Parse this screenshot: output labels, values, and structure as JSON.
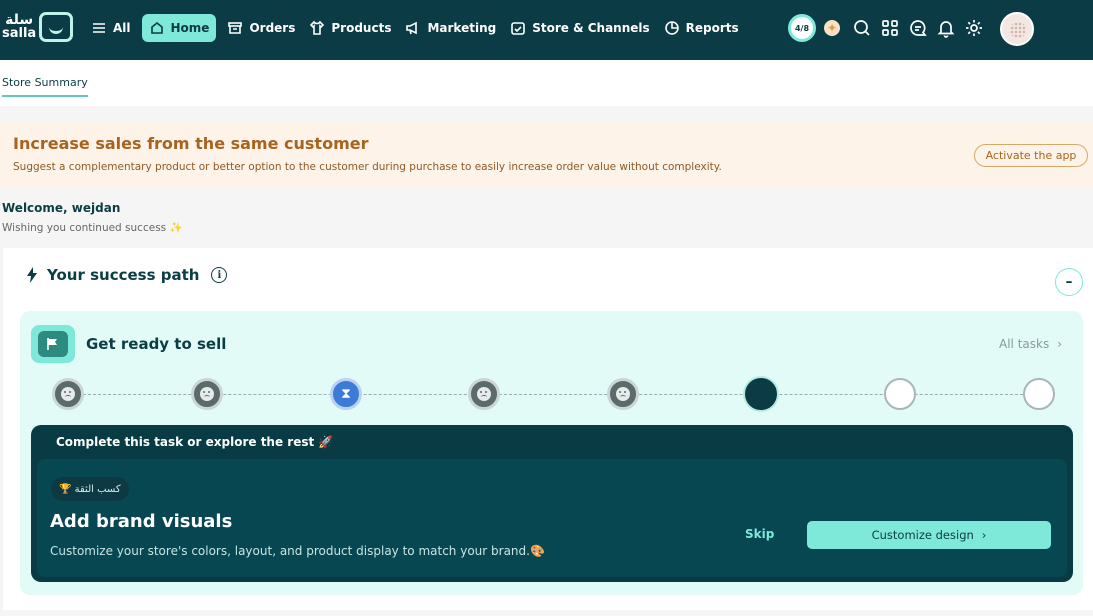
{
  "brand": {
    "name_ar": "سلة",
    "name_en": "salla"
  },
  "nav": {
    "items": [
      {
        "label": "All",
        "icon": "menu-icon"
      },
      {
        "label": "Home",
        "icon": "home-icon",
        "active": true
      },
      {
        "label": "Orders",
        "icon": "box-icon"
      },
      {
        "label": "Products",
        "icon": "shirt-icon"
      },
      {
        "label": "Marketing",
        "icon": "megaphone-icon"
      },
      {
        "label": "Store & Channels",
        "icon": "store-icon"
      },
      {
        "label": "Reports",
        "icon": "pie-chart-icon"
      }
    ]
  },
  "header_tools": {
    "progress": "4/8",
    "icons": [
      "sparkle-icon",
      "search-icon",
      "apps-grid-icon",
      "chat-icon",
      "bell-icon",
      "gear-icon"
    ]
  },
  "tabs": {
    "active_label": "Store Summary"
  },
  "banner": {
    "title": "Increase sales from the same customer",
    "description": "Suggest a complementary product or better option to the customer during purchase to easily increase order value without complexity.",
    "button": "Activate the app"
  },
  "welcome": {
    "greeting": "Welcome,  wejdan",
    "subtitle": "Wishing you continued success ✨"
  },
  "success_path": {
    "title": "Your success path",
    "collapse": "–",
    "panel": {
      "title": "Get ready to sell",
      "all_tasks": "All tasks",
      "steps": [
        {
          "state": "done"
        },
        {
          "state": "done"
        },
        {
          "state": "current"
        },
        {
          "state": "done"
        },
        {
          "state": "done"
        },
        {
          "state": "active"
        },
        {
          "state": "empty"
        },
        {
          "state": "empty"
        }
      ],
      "task": {
        "header": "Complete this task or explore the rest 🚀",
        "chip": "🏆 كسب الثقة",
        "title": "Add brand visuals",
        "description": "Customize your store's colors, layout, and product display to match your brand.🎨",
        "skip": "Skip",
        "cta": "Customize design"
      }
    }
  },
  "colors": {
    "topbar": "#0b3b44",
    "accent": "#7ee8d9",
    "banner_bg": "#fdf3e8",
    "banner_text": "#a8641f",
    "task_bg": "#093b44"
  }
}
